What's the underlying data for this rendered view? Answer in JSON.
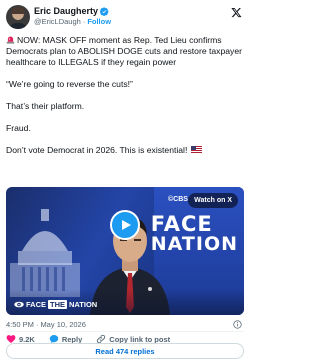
{
  "author": {
    "name": "Eric Daugherty",
    "handle": "@EricLDaugh",
    "separator": "·",
    "follow_label": "Follow",
    "verified": true
  },
  "tweet": {
    "line1": "NOW: MASK OFF moment as Rep. Ted Lieu confirms Democrats plan to ABOLISH DOGE cuts and restore taxpayer healthcare to ILLEGALS if they regain power",
    "line2": "“We’re going to reverse the cuts!”",
    "line3": "That’s their platform.",
    "line4": "Fraud.",
    "line5": "Don’t vote Democrat in 2026. This is existential!"
  },
  "video": {
    "watch_label": "Watch on X",
    "network_label": "©CBS",
    "show_title_1": "FACE",
    "show_title_2": "NATION",
    "badge_prefix": "FACE",
    "badge_box": "THE",
    "badge_suffix": "NATION"
  },
  "meta": {
    "time": "4:50 PM",
    "separator": "·",
    "date": "May 10, 2026"
  },
  "actions": {
    "like_count": "9.2K",
    "reply_label": "Reply",
    "copy_label": "Copy link to post"
  },
  "replies_button": "Read 474 replies",
  "colors": {
    "accent": "#1d9bf0",
    "link": "#006fd6",
    "like": "#f91880",
    "muted": "#536471",
    "video_blue": "#1a2e6b"
  },
  "icons": [
    "siren-icon",
    "verified-badge-icon",
    "x-logo-icon",
    "play-icon",
    "heart-icon",
    "reply-icon",
    "link-icon",
    "info-icon",
    "us-flag-icon"
  ]
}
